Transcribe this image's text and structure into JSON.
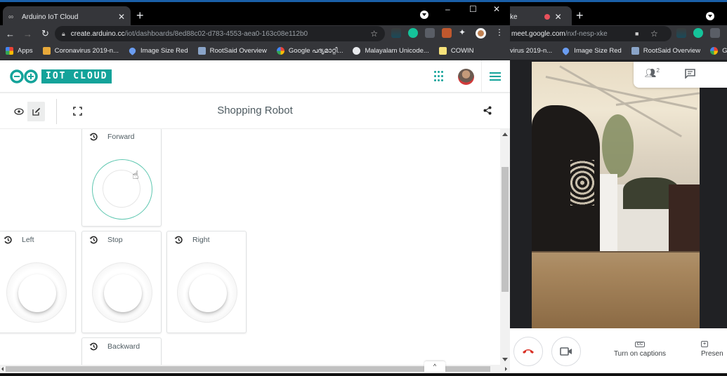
{
  "left_browser": {
    "tab": {
      "title": "Arduino IoT Cloud",
      "favicon": "infinity-icon"
    },
    "new_tab_label": "+",
    "window_controls": {
      "minimize": "–",
      "maximize": "☐",
      "close": "✕"
    },
    "url": {
      "host": "create.arduino.cc",
      "path": "/iot/dashboards/8ed88c02-d783-4553-aea0-163c08e112b0"
    },
    "bookmarks": [
      {
        "label": "Apps",
        "icon": "apps-grid-icon"
      },
      {
        "label": "Coronavirus 2019-n...",
        "icon": "folder-icon"
      },
      {
        "label": "Image Size Red",
        "icon": "heart-icon"
      },
      {
        "label": "RootSaid Overview",
        "icon": "site-icon"
      },
      {
        "label": "Google പദ്യമാറ്റി...",
        "icon": "google-icon"
      },
      {
        "label": "Malayalam Unicode...",
        "icon": "globe-icon"
      },
      {
        "label": "COWIN",
        "icon": "bookmark-icon"
      }
    ]
  },
  "iot_page": {
    "brand": {
      "logo_text": "IOT CLOUD",
      "accent": "#14a39a"
    },
    "dashboard": {
      "title": "Shopping Robot"
    },
    "widgets": [
      {
        "label": "Forward",
        "type": "push-button",
        "pressed": true
      },
      {
        "label": "Left",
        "type": "push-button",
        "pressed": false
      },
      {
        "label": "Stop",
        "type": "push-button",
        "pressed": false
      },
      {
        "label": "Right",
        "type": "push-button",
        "pressed": false
      },
      {
        "label": "Backward",
        "type": "push-button",
        "pressed": false
      }
    ],
    "collapse_label": "^"
  },
  "right_browser": {
    "tab": {
      "title": "ke",
      "recording": true
    },
    "new_tab_label": "+",
    "url": {
      "host": "meet.google.com",
      "path": "/nxf-nesp-xke"
    },
    "bookmarks": [
      {
        "label": "virus 2019-n...",
        "icon": "folder-icon"
      },
      {
        "label": "Image Size Red",
        "icon": "heart-icon"
      },
      {
        "label": "RootSaid Overview",
        "icon": "site-icon"
      },
      {
        "label": "Goog",
        "icon": "google-icon"
      }
    ],
    "meet": {
      "participants_count": "2",
      "controls": {
        "captions_label": "Turn on captions",
        "present_label": "Presen"
      }
    }
  }
}
